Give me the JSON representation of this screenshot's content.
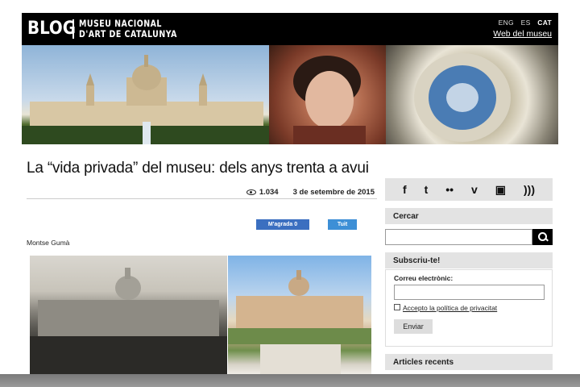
{
  "header": {
    "logo": "BLOG",
    "subtitle_line1": "MUSEU NACIONAL",
    "subtitle_line2": "D'ART DE CATALUNYA",
    "languages": [
      "ENG",
      "ES",
      "CAT"
    ],
    "active_language": "CAT",
    "web_link": "Web del museu"
  },
  "article": {
    "title": "La “vida privada” del museu: dels anys trenta a avui",
    "views": "1.034",
    "date": "3 de setembre de 2015",
    "facebook_label": "M'agrada 0",
    "tweet_label": "Tuit",
    "author": "Montse Gumà"
  },
  "sidebar": {
    "social_icons": [
      "facebook-icon",
      "twitter-icon",
      "flickr-icon",
      "vimeo-icon",
      "blogger-icon",
      "rss-icon"
    ],
    "social_glyphs": [
      "f",
      "t",
      "••",
      "v",
      "▣",
      ")))"
    ],
    "search_title": "Cercar",
    "subscribe_title": "Subscriu-te!",
    "email_label": "Correu electrònic:",
    "privacy_label": "Accepto la política de privacitat",
    "send_label": "Enviar",
    "recent_title": "Articles recents"
  }
}
